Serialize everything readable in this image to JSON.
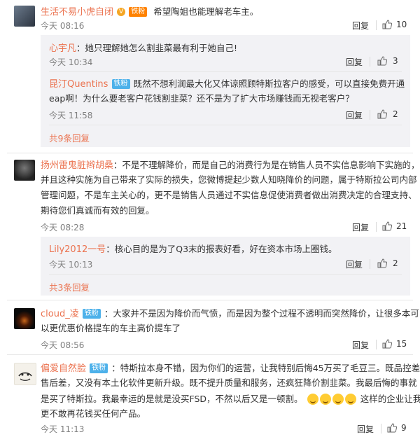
{
  "actions": {
    "reply": "回复"
  },
  "comments": [
    {
      "user": "生活不易小虎自闭",
      "badge": "铁粉",
      "text": "希望陶姐也能理解老车主。",
      "time": "今天 08:16",
      "likes": "10",
      "replies": [
        {
          "user": "心宇凡",
          "text": "她只理解她怎么割韭菜最有利于她自己!",
          "time": "今天 10:34",
          "likes": "3"
        },
        {
          "user": "昆汀Quentins",
          "badge": "铁粉",
          "text_lines": [
            "既然不想利润最大化又体谅照顾特斯拉客户的感受，可以直接免费开通",
            "eap啊！为什么要老客户花钱割韭菜？还不是为了扩大市场赚钱而无视老客户？"
          ],
          "time": "今天 11:58",
          "likes": "2"
        }
      ],
      "more": "共9条回复"
    },
    {
      "user": "扬州雷鬼脏辫胡桑",
      "text_lines": [
        "：不是不理解降价，而是自己的消费行为是在销售人员不实信息影响下实施的，",
        "并且这种实施为自己带来了实际的损失，您微博提起少数人知晓降价的问题，属于特斯拉公司内部",
        "管理问题，不是车主关心的，更不是销售人员通过不实信息促使消费者做出消费决定的合理支持、",
        "期待您们真诚而有效的回复。"
      ],
      "time": "今天 08:28",
      "likes": "21",
      "replies": [
        {
          "user": "Lily2012一号",
          "text": "核心目的是为了Q3末的报表好看，好在资本市场上圈钱。",
          "time": "今天 10:13",
          "likes": "2"
        }
      ],
      "more": "共3条回复"
    },
    {
      "user": "cloud_凌",
      "badge": "铁粉",
      "text_lines": [
        "大家并不是因为降价而气愤，而是因为整个过程不透明而突然降价，让很多本可",
        "以更优惠价格提车的车主高价提车了"
      ],
      "time": "今天 08:56",
      "likes": "15"
    },
    {
      "user": "偏爱自然脸",
      "badge": "铁粉",
      "text_lines": [
        "特斯拉本身不错，因为你们的运营，让我特别后悔45万买了毛豆三。既品控差、",
        "售后差，又没有本土化软件更新升级。既不提升质量和服务，还疯狂降价割韭菜。我最后悔的事就",
        "是买了特斯拉。我最幸运的是就是没买FSD，不然以后又是一顿割。",
        "这样的企业让我",
        "更不敢再花钱买任何产品。"
      ],
      "time": "今天 11:13",
      "likes": "9"
    }
  ]
}
